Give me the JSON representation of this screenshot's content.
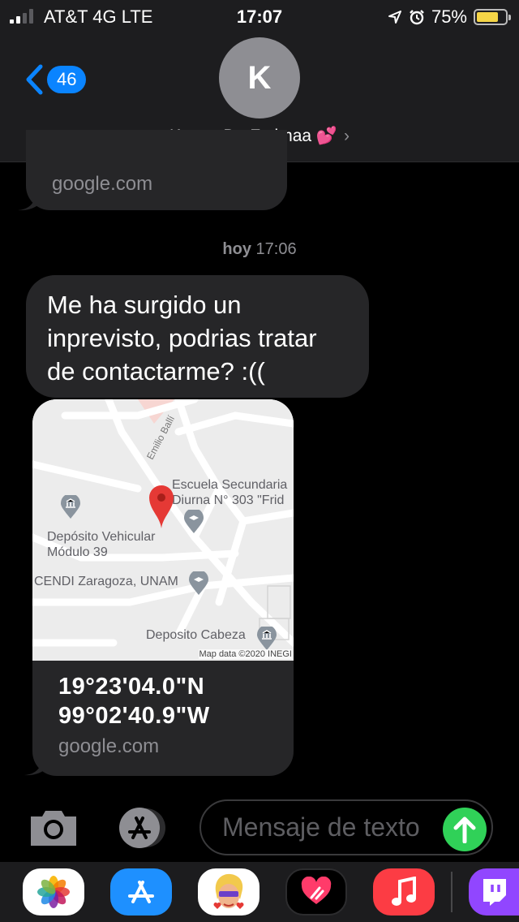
{
  "status_bar": {
    "carrier": "AT&T 4G  LTE",
    "time": "17:07",
    "battery": "75%",
    "battery_level": 0.75
  },
  "header": {
    "back_count": "46",
    "avatar_initial": "K",
    "contact_name": "Kanan De Fatimaa 💕",
    "chevron": "›"
  },
  "messages": {
    "previous_url": "google.com",
    "timestamp_day": "hoy",
    "timestamp_time": "17:06",
    "text": "Me ha surgido un inprevisto, podrias tratar de contactarme? :((",
    "location": {
      "lat": "19°23'04.0\"N",
      "lng": "99°02'40.9\"W",
      "url": "google.com",
      "map_labels": {
        "street": "Emilio Ballí",
        "school_line1": "Escuela Secundaria",
        "school_line2": "Diurna N° 303 \"Frid",
        "deposit_line1": "Depósito Vehicular",
        "deposit_line2": "Módulo 39",
        "cendi": "CENDI Zaragoza, UNAM",
        "deposito_cabeza": "Deposito Cabeza",
        "attribution": "Map data ©2020 INEGI"
      }
    }
  },
  "input": {
    "placeholder": "Mensaje de texto"
  },
  "app_drawer": [
    {
      "name": "photos-app-icon",
      "color": "#ffffff"
    },
    {
      "name": "app-store-icon",
      "color": "#1e90ff"
    },
    {
      "name": "memoji-icon",
      "color": "#ffffff"
    },
    {
      "name": "digital-touch-icon",
      "color": "#000000"
    },
    {
      "name": "music-app-icon",
      "color": "#fc3c44"
    },
    {
      "name": "twitch-app-icon",
      "color": "#9146ff"
    }
  ]
}
